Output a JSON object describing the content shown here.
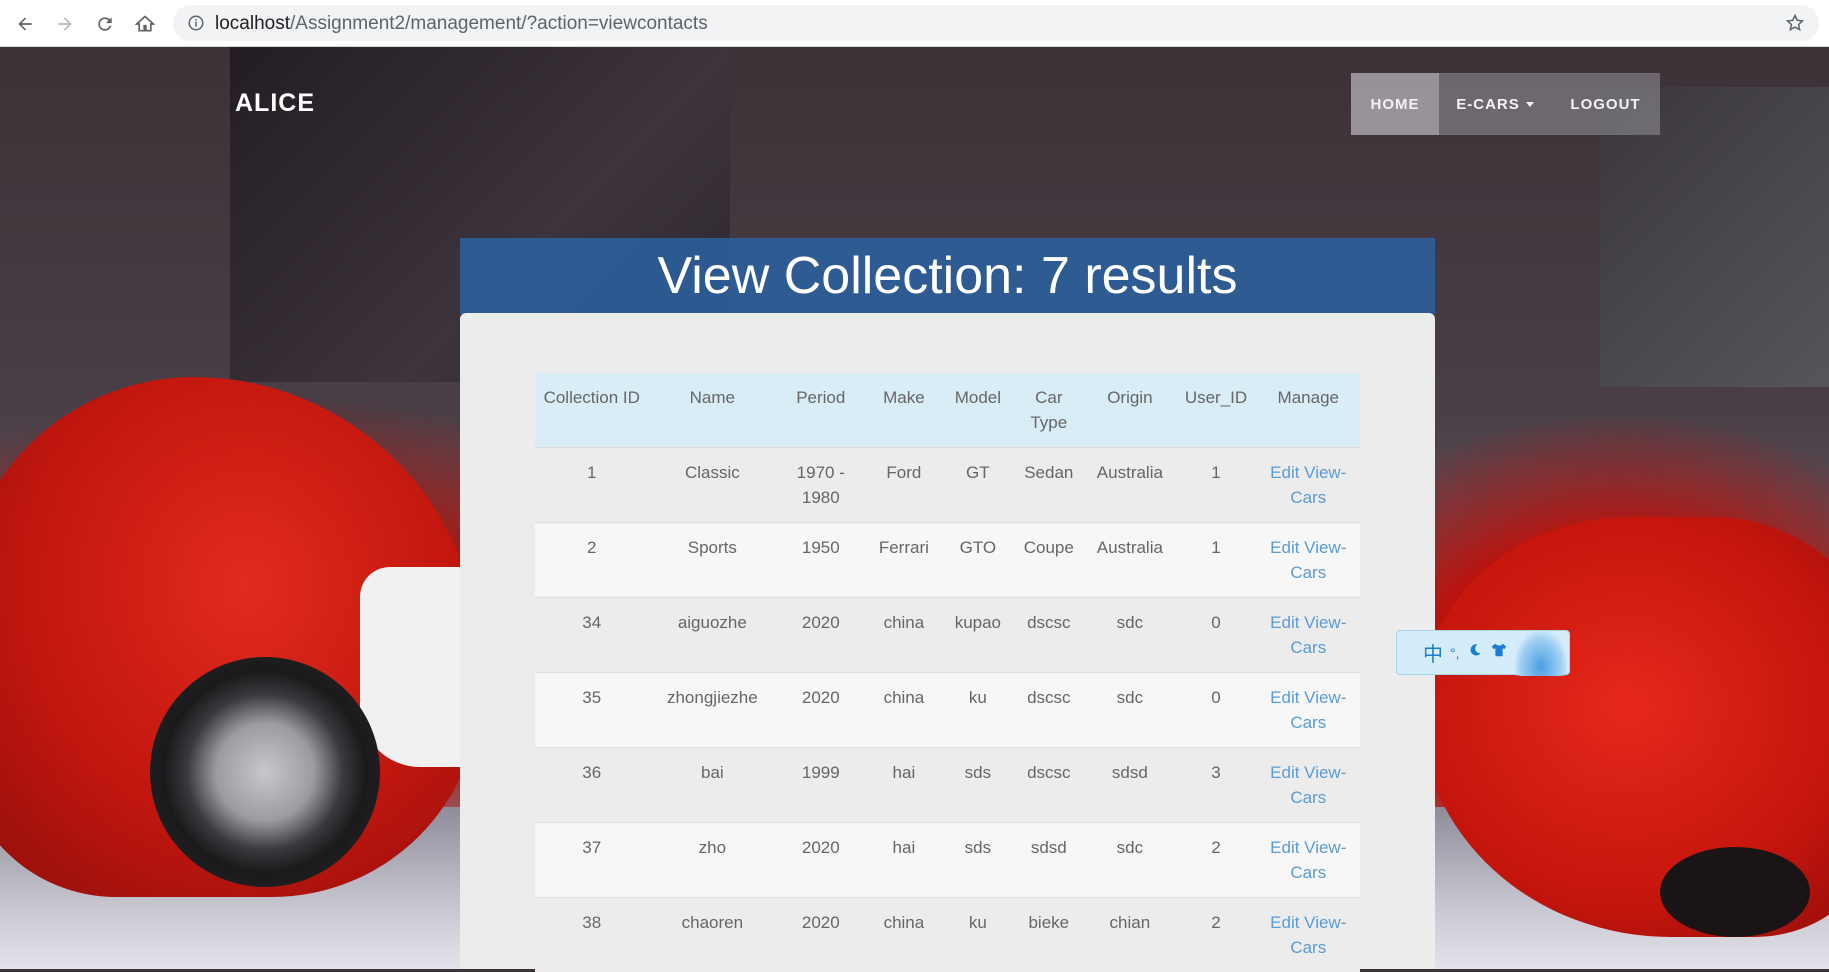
{
  "browser": {
    "url_host": "localhost",
    "url_path": "/Assignment2/management/?action=viewcontacts",
    "icons": [
      "back-arrow-icon",
      "forward-arrow-icon",
      "reload-icon",
      "home-icon",
      "info-icon",
      "star-icon"
    ]
  },
  "navbar": {
    "brand": "ALICE",
    "items": [
      {
        "label": "HOME"
      },
      {
        "label": "E-CARS"
      },
      {
        "label": "LOGOUT"
      }
    ]
  },
  "main": {
    "heading": "View Collection: 7 results",
    "table": {
      "headers": [
        "Collection ID",
        "Name",
        "Period",
        "Make",
        "Model",
        "Car Type",
        "Origin",
        "User_ID",
        "Manage"
      ],
      "rows": [
        {
          "id": "1",
          "name": "Classic",
          "period": "1970 - 1980",
          "make": "Ford",
          "model": "GT",
          "type": "Sedan",
          "origin": "Australia",
          "user": "1"
        },
        {
          "id": "2",
          "name": "Sports",
          "period": "1950",
          "make": "Ferrari",
          "model": "GTO",
          "type": "Coupe",
          "origin": "Australia",
          "user": "1"
        },
        {
          "id": "34",
          "name": "aiguozhe",
          "period": "2020",
          "make": "china",
          "model": "kupao",
          "type": "dscsc",
          "origin": "sdc",
          "user": "0"
        },
        {
          "id": "35",
          "name": "zhongjiezhe",
          "period": "2020",
          "make": "china",
          "model": "ku",
          "type": "dscsc",
          "origin": "sdc",
          "user": "0"
        },
        {
          "id": "36",
          "name": "bai",
          "period": "1999",
          "make": "hai",
          "model": "sds",
          "type": "dscsc",
          "origin": "sdsd",
          "user": "3"
        },
        {
          "id": "37",
          "name": "zho",
          "period": "2020",
          "make": "hai",
          "model": "sds",
          "type": "sdsd",
          "origin": "sdc",
          "user": "2"
        },
        {
          "id": "38",
          "name": "chaoren",
          "period": "2020",
          "make": "china",
          "model": "ku",
          "type": "bieke",
          "origin": "chian",
          "user": "2"
        }
      ],
      "manage_label": "Edit View-Cars"
    }
  },
  "ime": {
    "chinese_mode": "中",
    "punctuation": "°,",
    "icons": [
      "moon-icon",
      "shirt-icon",
      "flower-icon"
    ]
  },
  "colors": {
    "header_bg": "#2b609d",
    "table_header_bg": "#d9edf7",
    "link": "#5a9bd4"
  }
}
